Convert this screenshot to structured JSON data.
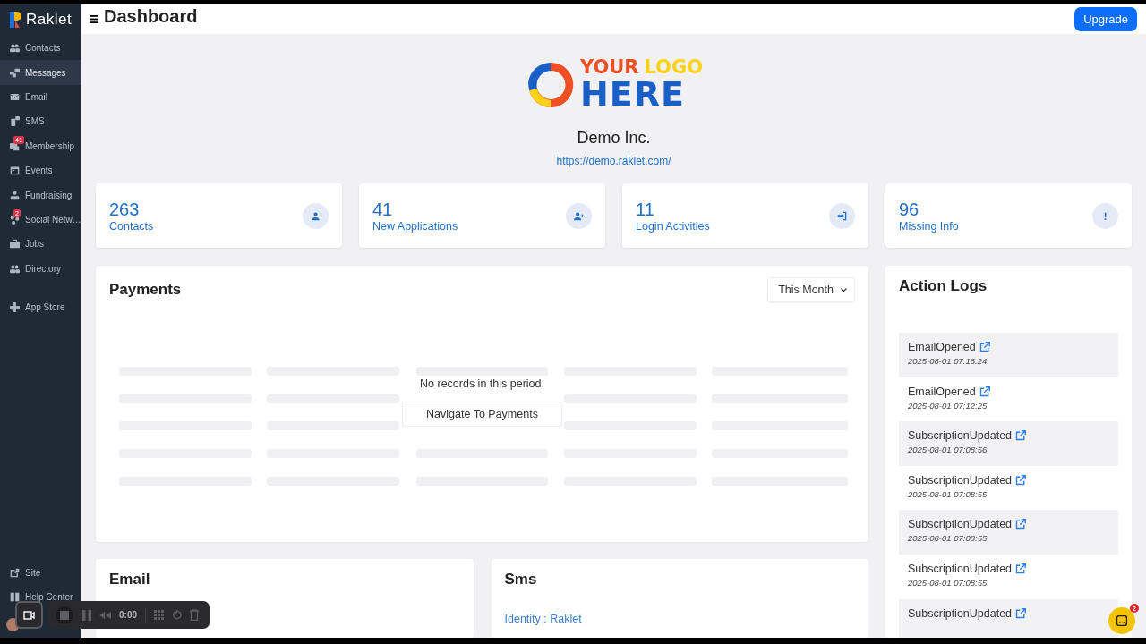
{
  "sidebar": {
    "brand": "Raklet",
    "items": [
      {
        "label": "Contacts",
        "selected": false
      },
      {
        "label": "Messages",
        "selected": true
      },
      {
        "label": "Email",
        "selected": false
      },
      {
        "label": "SMS",
        "selected": false
      },
      {
        "label": "Membership",
        "selected": false,
        "badge": "41"
      },
      {
        "label": "Events",
        "selected": false
      },
      {
        "label": "Fundraising",
        "selected": false
      },
      {
        "label": "Social Netw…",
        "selected": false,
        "badge": "2"
      },
      {
        "label": "Jobs",
        "selected": false
      },
      {
        "label": "Directory",
        "selected": false
      }
    ],
    "secondary_items": [
      {
        "label": "App Store",
        "selected": false
      }
    ],
    "footer_items": [
      {
        "label": "Site",
        "selected": false
      },
      {
        "label": "Help Center",
        "selected": false
      }
    ]
  },
  "header": {
    "title": "Dashboard",
    "upgrade_button": "Upgrade"
  },
  "organization": {
    "logo_words": [
      "YOUR",
      "LOGO",
      "HERE"
    ],
    "name": "Demo Inc.",
    "url": "https://demo.raklet.com/"
  },
  "stats": [
    {
      "value": "263",
      "label": "Contacts"
    },
    {
      "value": "41",
      "label": "New Applications"
    },
    {
      "value": "11",
      "label": "Login Activities"
    },
    {
      "value": "96",
      "label": "Missing Info"
    }
  ],
  "payments": {
    "title": "Payments",
    "period_select": "This Month",
    "empty_message": "No records in this period.",
    "navigate_button": "Navigate To Payments"
  },
  "action_logs": {
    "title": "Action Logs",
    "items": [
      {
        "event": "EmailOpened",
        "time": "2025-08-01 07:18:24"
      },
      {
        "event": "EmailOpened",
        "time": "2025-08-01 07:12:25"
      },
      {
        "event": "SubscriptionUpdated",
        "time": "2025-08-01 07:08:56"
      },
      {
        "event": "SubscriptionUpdated",
        "time": "2025-08-01 07:08:55"
      },
      {
        "event": "SubscriptionUpdated",
        "time": "2025-08-01 07:08:55"
      },
      {
        "event": "SubscriptionUpdated",
        "time": "2025-08-01 07:08:55"
      },
      {
        "event": "SubscriptionUpdated"
      }
    ]
  },
  "email": {
    "title": "Email"
  },
  "sms": {
    "title": "Sms",
    "identity": "Identity : Raklet"
  },
  "recorder": {
    "time": "0:00"
  },
  "chat": {
    "badge": "2"
  }
}
